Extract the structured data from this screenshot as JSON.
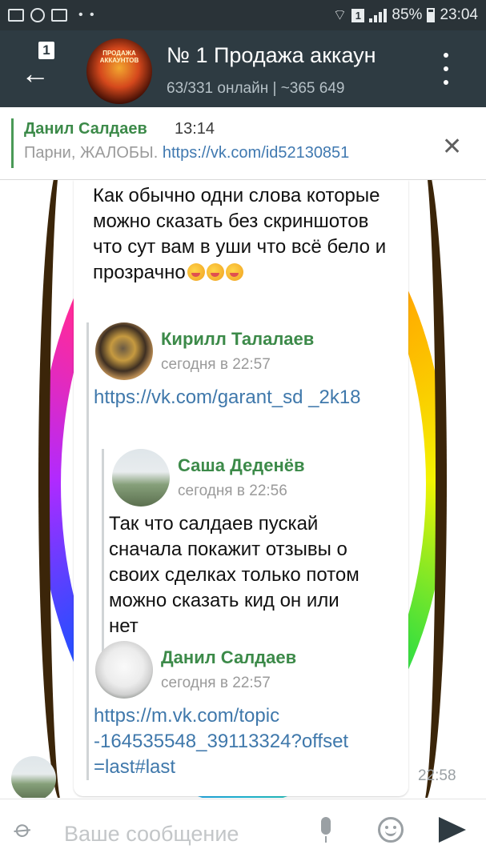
{
  "status_bar": {
    "sim_badge": "1",
    "battery": "85%",
    "time": "23:04"
  },
  "header": {
    "back_badge": "1",
    "channel_title": "№ 1 Продажа аккаун",
    "channel_subtitle": "63/331 онлайн | ~365 649",
    "avatar_caption": "ПРОДАЖА АККАУНТОВ"
  },
  "pinned": {
    "author": "Данил Салдаев",
    "time": "13:14",
    "text": "Парни, ЖАЛОБЫ.",
    "link": "https://vk.com/id52130851"
  },
  "message": {
    "text": "Как обычно одни слова которые можно сказать без скриншотов что сут вам в уши что всё бело и прозрачно",
    "time": "22:58",
    "forwarded": [
      {
        "author": "Кирилл Талалаев",
        "date": "сегодня в 22:57",
        "link": "https://vk.com/garant_sd _2k18"
      },
      {
        "author": "Саша Деденёв",
        "date": "сегодня в 22:56",
        "text": "Так что салдаев пускай сначала покажит отзывы о своих сделках только потом можно сказать кид он или нет"
      },
      {
        "author": "Данил Салдаев",
        "date": "сегодня в 22:57",
        "link": "https://m.vk.com/topic -164535548_39113324?offset =last#last"
      }
    ]
  },
  "composer": {
    "placeholder": "Ваше сообщение"
  }
}
